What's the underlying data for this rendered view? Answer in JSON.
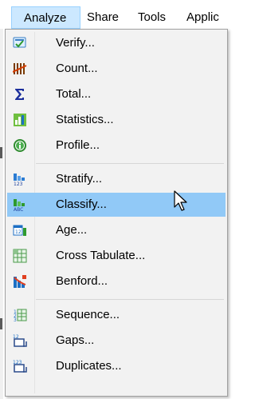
{
  "menubar": {
    "analyze": "Analyze",
    "share": "Share",
    "tools": "Tools",
    "applications": "Applic"
  },
  "menu": {
    "items": [
      {
        "label": "Verify...",
        "icon": "verify-icon"
      },
      {
        "label": "Count...",
        "icon": "count-icon"
      },
      {
        "label": "Total...",
        "icon": "sigma-icon"
      },
      {
        "label": "Statistics...",
        "icon": "statistics-icon"
      },
      {
        "label": "Profile...",
        "icon": "profile-icon"
      },
      {
        "label": "Stratify...",
        "icon": "stratify-icon"
      },
      {
        "label": "Classify...",
        "icon": "classify-icon",
        "highlighted": true
      },
      {
        "label": "Age...",
        "icon": "age-icon"
      },
      {
        "label": "Cross Tabulate...",
        "icon": "cross-tabulate-icon"
      },
      {
        "label": "Benford...",
        "icon": "benford-icon"
      },
      {
        "label": "Sequence...",
        "icon": "sequence-icon"
      },
      {
        "label": "Gaps...",
        "icon": "gaps-icon"
      },
      {
        "label": "Duplicates...",
        "icon": "duplicates-icon"
      }
    ]
  },
  "colors": {
    "menu_background": "#f2f2f2",
    "highlight": "#91c9f7",
    "menubar_active": "#cce8ff"
  }
}
